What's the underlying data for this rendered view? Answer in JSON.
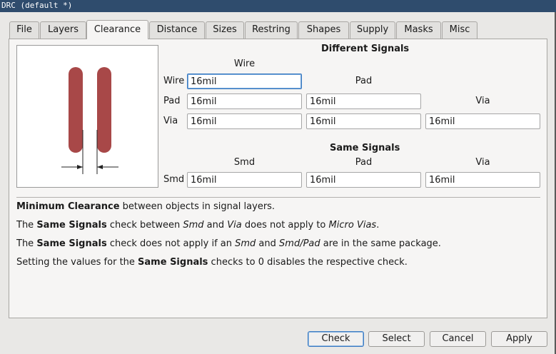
{
  "window": {
    "title": "DRC (default *)"
  },
  "tabs": [
    "File",
    "Layers",
    "Clearance",
    "Distance",
    "Sizes",
    "Restring",
    "Shapes",
    "Supply",
    "Masks",
    "Misc"
  ],
  "active_tab": "Clearance",
  "different_signals": {
    "heading": "Different Signals",
    "col_wire": "Wire",
    "col_pad": "Pad",
    "col_via": "Via",
    "row_wire_label": "Wire",
    "row_pad_label": "Pad",
    "row_via_label": "Via",
    "wire_wire": "16mil",
    "pad_wire": "16mil",
    "pad_pad": "16mil",
    "via_wire": "16mil",
    "via_pad": "16mil",
    "via_via": "16mil"
  },
  "same_signals": {
    "heading": "Same Signals",
    "col_smd": "Smd",
    "col_pad": "Pad",
    "col_via": "Via",
    "row_label": "Smd",
    "smd_smd": "16mil",
    "smd_pad": "16mil",
    "smd_via": "16mil"
  },
  "description": {
    "line1_bold": "Minimum Clearance",
    "line1_rest": " between objects in signal layers.",
    "line2_a": "The ",
    "line2_bold": "Same Signals",
    "line2_b": " check between ",
    "line2_i1": "Smd",
    "line2_c": " and ",
    "line2_i2": "Via",
    "line2_d": " does not apply to ",
    "line2_i3": "Micro Vias",
    "line2_e": ".",
    "line3_a": "The ",
    "line3_bold": "Same Signals",
    "line3_b": " check does not apply if an ",
    "line3_i1": "Smd",
    "line3_c": " and ",
    "line3_i2": "Smd/Pad",
    "line3_d": " are in the same package.",
    "line4_a": "Setting the values for the ",
    "line4_bold": "Same Signals",
    "line4_b": " checks to 0 disables the respective check."
  },
  "buttons": {
    "check": "Check",
    "select": "Select",
    "cancel": "Cancel",
    "apply": "Apply"
  },
  "colors": {
    "title_bar": "#2f4c6d",
    "trace": "#a84848",
    "focus": "#3d7cc2"
  }
}
